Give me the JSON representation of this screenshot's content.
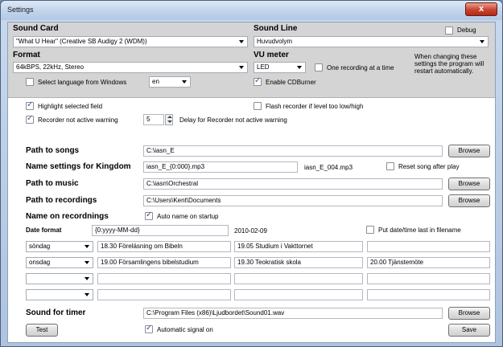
{
  "window": {
    "title": "Settings",
    "close_label": "x"
  },
  "top": {
    "sound_card_header": "Sound Card",
    "sound_card_value": "\"What U Hear\" (Creative SB Audigy 2 (WDM))",
    "sound_line_header": "Sound Line",
    "sound_line_value": "Huvudvolym",
    "debug_label": "Debug",
    "format_header": "Format",
    "format_value": "64kBPS, 22kHz, Stereo",
    "vu_header": "VU meter",
    "vu_value": "LED",
    "one_recording_label": "One recording at a time",
    "restart_note": "When changing these settings the program will restart automatically.",
    "select_language_label": "Select language from Windows",
    "language_value": "en",
    "enable_cdburner_label": "Enable CDBurner"
  },
  "options": {
    "highlight_label": "Highlight selected field",
    "flash_label": "Flash recorder if level too low/high",
    "not_active_label": "Recorder not active warning",
    "delay_value": "5",
    "delay_label": "Delay for Recorder not active warning"
  },
  "paths": {
    "songs_label": "Path to songs",
    "songs_value": "C:\\iasn_E",
    "name_kingdom_label": "Name settings for Kingdom",
    "name_kingdom_value": "iasn_E_{0:000}.mp3",
    "name_kingdom_example": "iasn_E_004.mp3",
    "reset_song_label": "Reset song after play",
    "music_label": "Path to music",
    "music_value": "C:\\iasn\\Orchestral",
    "recordings_label": "Path to recordings",
    "recordings_value": "C:\\Users\\Kent\\Documents",
    "name_recordings_label": "Name on recordnings",
    "auto_name_label": "Auto name on startup",
    "date_format_label": "Date format",
    "date_format_value": "{0:yyyy-MM-dd}",
    "date_example": "2010-02-09",
    "put_date_label": "Put date/time last in filename",
    "browse_label": "Browse"
  },
  "schedule": [
    {
      "day": "söndag",
      "c1": "18.30 Föreläsning om Bibeln",
      "c2": "19.05 Studium i Vakttornet",
      "c3": ""
    },
    {
      "day": "onsdag",
      "c1": "19.00 Församlingens bibelstudium",
      "c2": "19.30 Teokratisk skola",
      "c3": "20.00 Tjänstemöte"
    },
    {
      "day": "",
      "c1": "",
      "c2": "",
      "c3": ""
    },
    {
      "day": "",
      "c1": "",
      "c2": "",
      "c3": ""
    }
  ],
  "timer": {
    "label": "Sound for timer",
    "value": "C:\\Program Files (x86)\\Ljudbordet\\Sound01.wav",
    "browse_label": "Browse",
    "test_label": "Test",
    "auto_signal_label": "Automatic signal on",
    "save_label": "Save"
  }
}
